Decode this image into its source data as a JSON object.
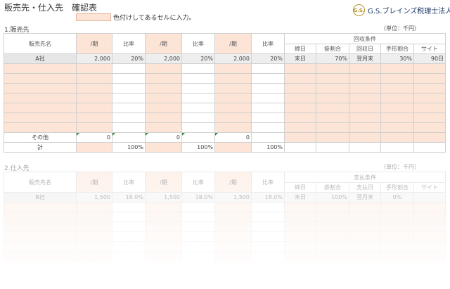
{
  "title": "販売先・仕入先　確認表",
  "legend": {
    "text": "色付けしてあるセルに入力。",
    "color": "#fce4d6"
  },
  "logo": {
    "seal": "G.S.",
    "name": "G.S.ブレインズ税理士法人"
  },
  "sales": {
    "title": "1.販売先",
    "unit": "（単位：千円）",
    "headers": {
      "name": "販売先名",
      "period": "/期",
      "ratio": "比率",
      "group": "回収条件",
      "close": "締日",
      "credit": "掛割合",
      "collect": "回収日",
      "bill": "手形割合",
      "site": "サイト"
    },
    "first_row": {
      "name": "A社",
      "p1": "2,000",
      "r1": "20%",
      "p2": "2,000",
      "r2": "20%",
      "p3": "2,000",
      "r3": "20%",
      "close": "末日",
      "credit": "70%",
      "collect": "翌月末",
      "bill": "30%",
      "site": "90日"
    },
    "other_row": {
      "label": "その他",
      "p1": "0",
      "p2": "0",
      "p3": "0"
    },
    "total_row": {
      "label": "計",
      "r1": "100%",
      "r2": "100%",
      "r3": "100%"
    }
  },
  "purchase": {
    "title": "2.仕入先",
    "unit": "（単位：千円）",
    "headers": {
      "name": "販売先名",
      "period": "/期",
      "ratio": "比率",
      "group": "支払条件",
      "close": "締日",
      "credit": "掛割合",
      "collect": "支払日",
      "bill": "手形割合",
      "site": "サイト"
    },
    "first_row": {
      "name": "B社",
      "p1": "1,500",
      "r1": "18.0%",
      "p2": "1,500",
      "r2": "18.0%",
      "p3": "1,500",
      "r3": "18.0%",
      "close": "末日",
      "credit": "100%",
      "collect": "翌月末",
      "bill": "0%",
      "site": ""
    }
  }
}
